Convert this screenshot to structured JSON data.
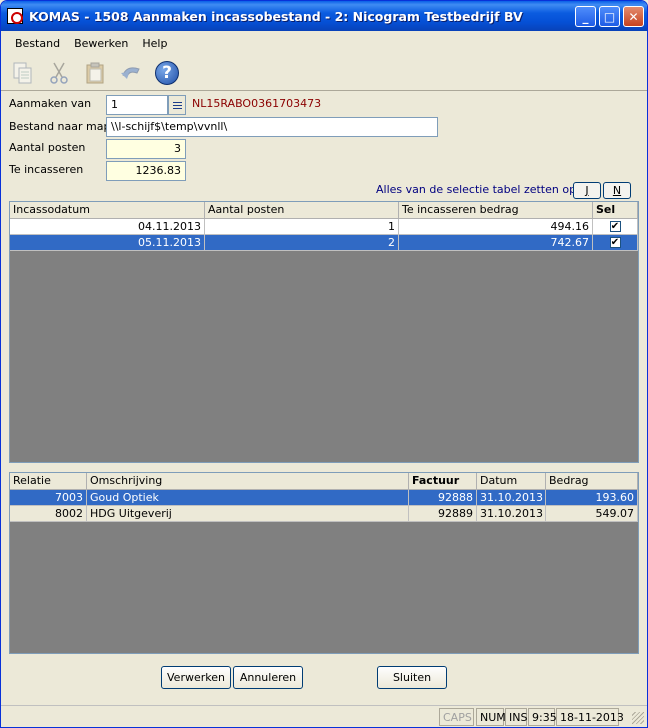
{
  "window": {
    "title": "KOMAS - 1508 Aanmaken incassobestand - 2: Nicogram Testbedrijf BV",
    "controls": {
      "minimize": "_",
      "maximize": "□",
      "close": "✕"
    }
  },
  "menu": {
    "bestand": "Bestand",
    "bewerken": "Bewerken",
    "help": "Help"
  },
  "toolbar": {
    "icons": [
      "copy-icon",
      "cut-icon",
      "paste-icon",
      "undo-icon",
      "help-icon"
    ],
    "help_glyph": "?"
  },
  "form": {
    "aanmaken_van_label": "Aanmaken van",
    "aanmaken_van_value": "1",
    "iban": "NL15RABO0361703473",
    "bestand_label": "Bestand naar map",
    "bestand_value": "\\\\l-schijf$\\temp\\vvnll\\",
    "aantal_label": "Aantal posten",
    "aantal_value": "3",
    "te_incasseren_label": "Te incasseren",
    "te_incasseren_value": "1236.83",
    "selectie_text": "Alles van de selectie tabel zetten op",
    "btn_j": "J",
    "btn_n": "N"
  },
  "grid1": {
    "headers": [
      "Incassodatum",
      "Aantal posten",
      "Te incasseren bedrag",
      "Sel"
    ],
    "rows": [
      {
        "datum": "04.11.2013",
        "aantal": "1",
        "bedrag": "494.16",
        "sel": "✔"
      },
      {
        "datum": "05.11.2013",
        "aantal": "2",
        "bedrag": "742.67",
        "sel": "✔"
      }
    ]
  },
  "grid2": {
    "headers": [
      "Relatie",
      "Omschrijving",
      "Factuur",
      "Datum",
      "Bedrag"
    ],
    "rows": [
      {
        "relatie": "7003",
        "omschrijving": "Goud Optiek",
        "factuur": "92888",
        "datum": "31.10.2013",
        "bedrag": "193.60"
      },
      {
        "relatie": "8002",
        "omschrijving": "HDG Uitgeverij",
        "factuur": "92889",
        "datum": "31.10.2013",
        "bedrag": "549.07"
      }
    ]
  },
  "buttons": {
    "verwerken": "Verwerken",
    "annuleren": "Annuleren",
    "sluiten": "Sluiten"
  },
  "status": {
    "caps": "CAPS",
    "num": "NUM",
    "ins": "INS",
    "time": "9:35",
    "date": "18-11-2013"
  }
}
